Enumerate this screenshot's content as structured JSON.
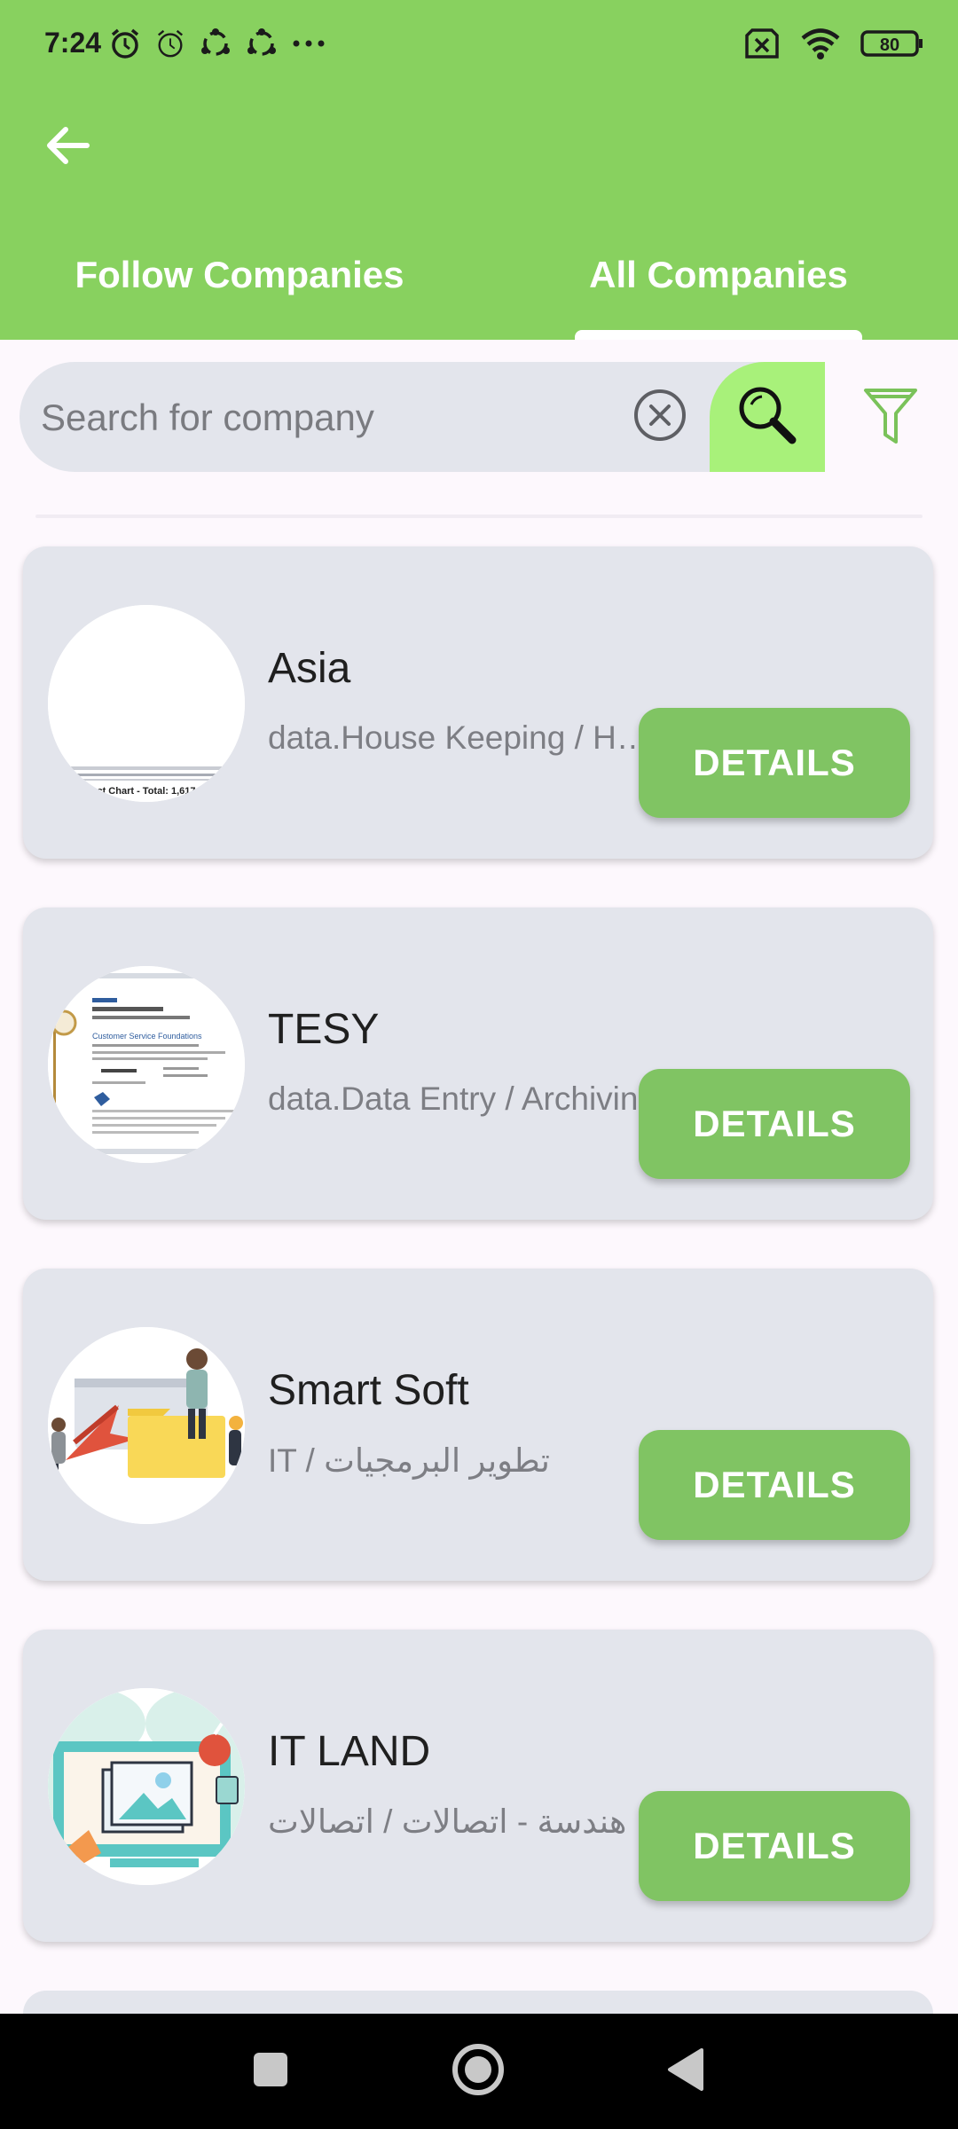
{
  "status_bar": {
    "time": "7:24",
    "left_icons": [
      "alarm-icon",
      "alarm-icon",
      "sync-icon",
      "sync-icon",
      "more-icon"
    ],
    "right_icons": [
      "no-sim-icon",
      "wifi-icon",
      "battery-icon"
    ],
    "battery": "80"
  },
  "header": {
    "back_icon": "arrow-left-icon",
    "tabs": [
      {
        "label": "Follow Companies",
        "selected": false
      },
      {
        "label": "All Companies",
        "selected": true
      }
    ]
  },
  "search": {
    "placeholder": "Search for company",
    "value": "",
    "clear_icon": "clear-circle-icon",
    "search_icon": "magnifier-icon",
    "filter_icon": "filter-icon"
  },
  "companies": [
    {
      "name": "Asia",
      "category": "data.House Keeping / House Keeping",
      "button": "DETAILS",
      "logo_caption": "ct Chart - Total: 1,617"
    },
    {
      "name": "TESY",
      "category": "data.Data Entry / Archiving",
      "button": "DETAILS",
      "logo_caption": "Customer Service Foundations"
    },
    {
      "name": "Smart Soft",
      "category": "IT / تطوير البرمجيات",
      "button": "DETAILS"
    },
    {
      "name": "IT LAND",
      "category": "هندسة - اتصالات / اتصالات",
      "button": "DETAILS"
    }
  ],
  "colors": {
    "header_green": "#88d15f",
    "button_green": "#80c463",
    "search_button_green": "#a8f17a",
    "card_bg": "#e3e5ec"
  },
  "navbar": {
    "buttons": [
      "recents-square-icon",
      "home-circle-icon",
      "back-triangle-icon"
    ]
  }
}
